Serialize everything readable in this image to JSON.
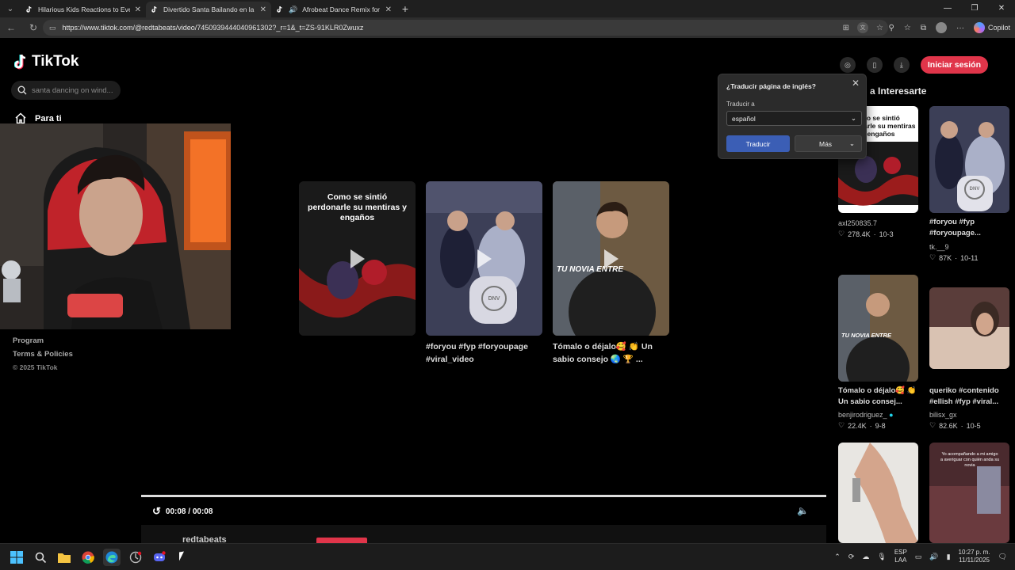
{
  "browser": {
    "tabs": [
      {
        "title": "Hilarious Kids Reactions to Everyo",
        "active": false
      },
      {
        "title": "Divertido Santa Bailando en la Fi",
        "active": true
      },
      {
        "title": "Afrobeat Dance Remix for 20",
        "active": false
      }
    ],
    "new_tab": "+",
    "url": "https://www.tiktok.com/@redtabeats/video/7450939444040961302?_r=1&_t=ZS-91KLR0Zwuxz",
    "copilot_label": "Copilot"
  },
  "tiktok": {
    "logo": "TikTok",
    "search_placeholder": "santa dancing on wind...",
    "nav_for_you": "Para ti",
    "footer": {
      "program": "Program",
      "terms": "Terms & Policies",
      "copyright": "© 2025 TikTok"
    },
    "login_button": "Iniciar sesión",
    "recommended_title": "a Interesarte",
    "related_videos": [
      {
        "overlay": "Como se sintió perdonarle su mentiras y engaños",
        "caption": ""
      },
      {
        "overlay": "",
        "caption": "#foryou #fyp #foryoupage #viral_video"
      },
      {
        "overlay": "TU NOVIA ENTRE",
        "caption": "Tómalo o déjalo🥰 👏 Un sabio consejo 🌏 🏆 ..."
      }
    ],
    "player": {
      "time": "00:08 / 00:08",
      "author": "redtabeats"
    },
    "recommended": [
      {
        "overlay": "omo se sintió perdonarle su mentiras y engaños",
        "caption": "",
        "user": "axl250835.7",
        "likes": "278.4K",
        "date": "10-3"
      },
      {
        "overlay": "",
        "caption": "#foryou #fyp #foryoupage...",
        "user": "tk.__9",
        "likes": "87K",
        "date": "10-11"
      },
      {
        "overlay": "TU NOVIA ENTRE",
        "caption": "Tómalo o déjalo🥰 👏 Un sabio consej...",
        "user": "benjirodriguez_",
        "likes": "22.4K",
        "date": "9-8"
      },
      {
        "overlay": "",
        "caption": "queriko #contenido #ellish #fyp #viral...",
        "user": "bilisx_gx",
        "likes": "82.6K",
        "date": "10-5"
      },
      {
        "overlay": "",
        "caption": "",
        "user": "",
        "likes": "",
        "date": ""
      },
      {
        "overlay": "Yo acompañando a mi amigo a averiguar con quién anda su novia",
        "caption": "",
        "user": "",
        "likes": "",
        "date": ""
      }
    ]
  },
  "translate_popup": {
    "title": "¿Traducir página de inglés?",
    "translate_to_label": "Traducir a",
    "language": "español",
    "translate_button": "Traducir",
    "more_button": "Más"
  },
  "taskbar": {
    "lang_top": "ESP",
    "lang_bottom": "LAA",
    "time": "10:27 p. m.",
    "date": "11/11/2025"
  },
  "colors": {
    "accent": "#e0354a",
    "translate_blue": "#3b5eb5"
  }
}
